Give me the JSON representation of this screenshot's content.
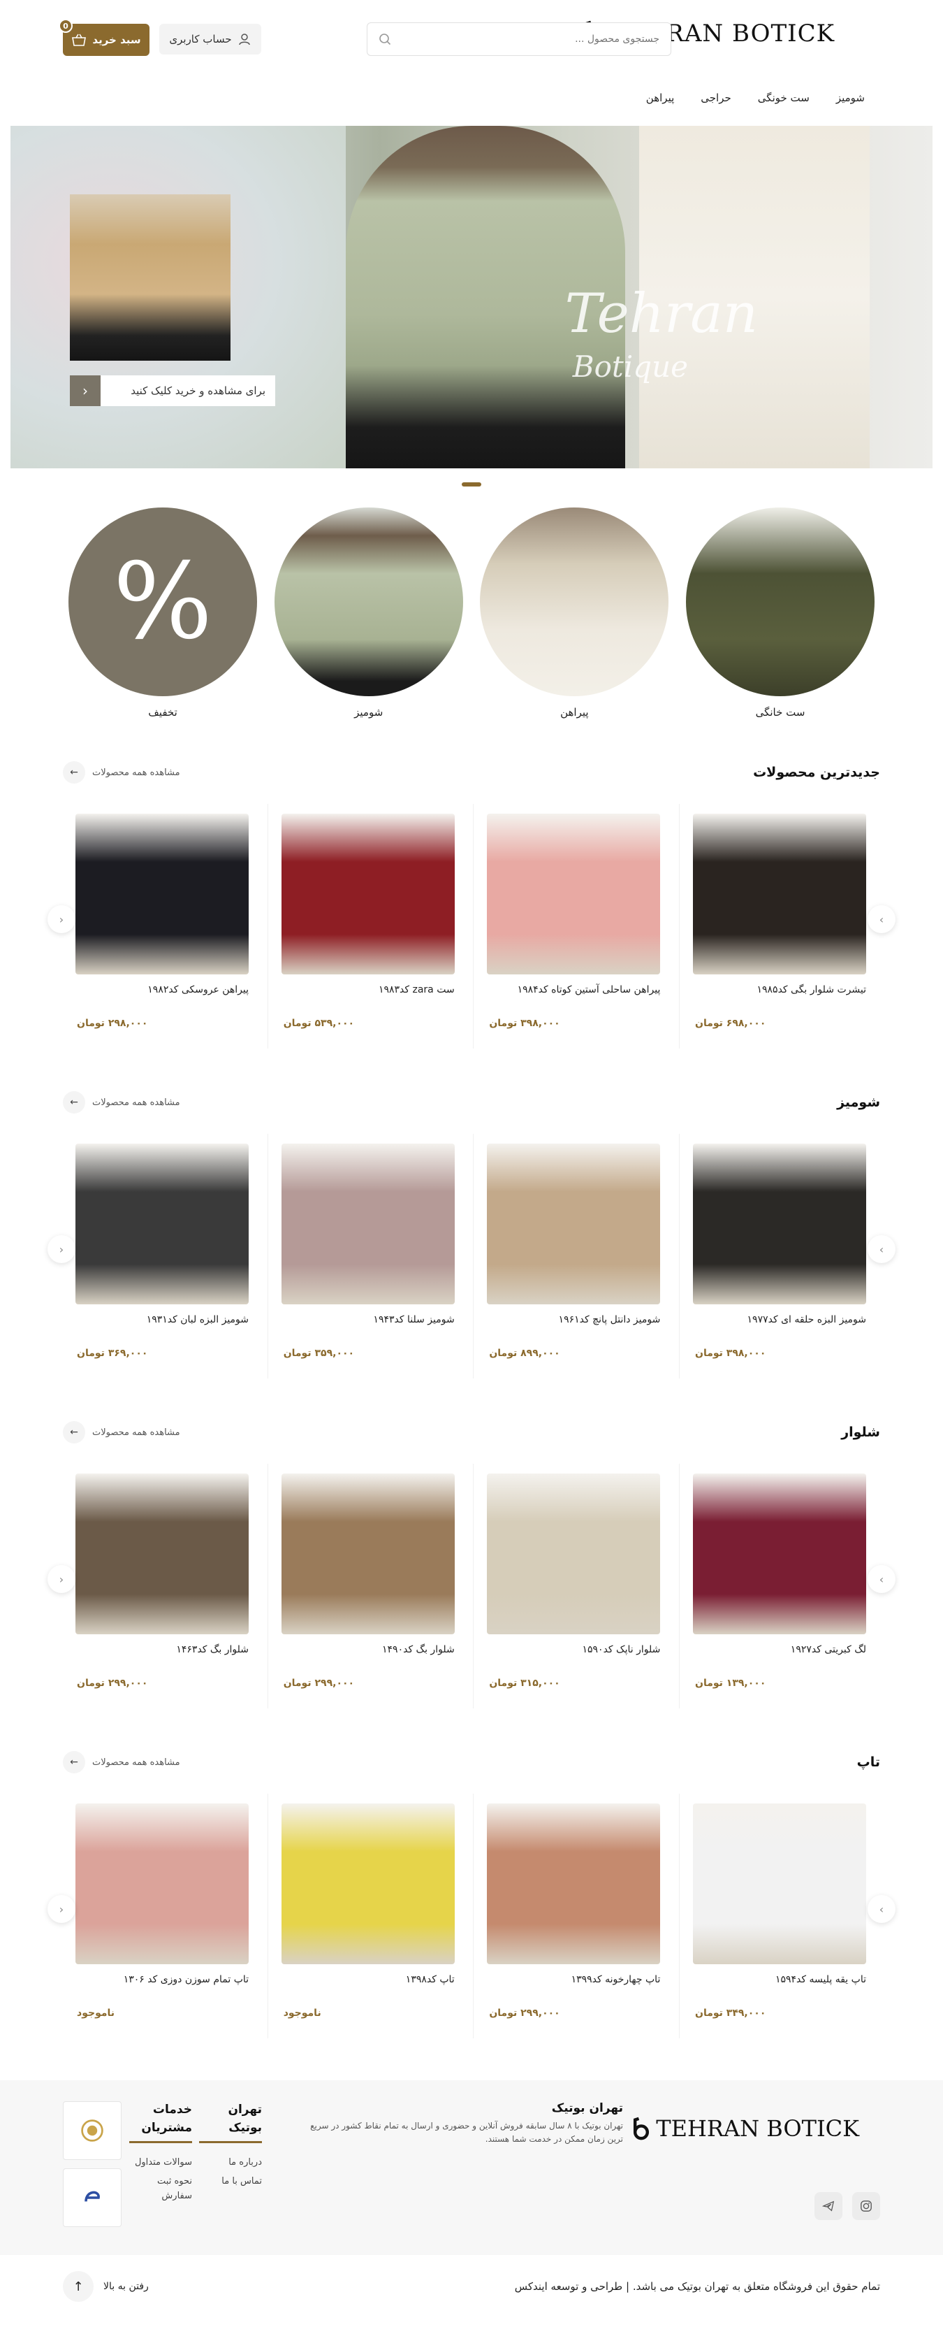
{
  "brand": {
    "logo_text": "TEHRAN BOTICK",
    "accent": "#8b6a2e"
  },
  "header": {
    "search_placeholder": "جستجوی محصول ...",
    "account_label": "حساب کاربری",
    "cart_label": "سبد خرید",
    "cart_count": "0"
  },
  "nav": {
    "items": [
      "شومیز",
      "ست خونگی",
      "حراجی",
      "پیراهن"
    ]
  },
  "hero": {
    "cta_label": "برای مشاهده و خرید کلیک کنید",
    "script_title": "Tehran",
    "script_sub": "Botique"
  },
  "categories": [
    {
      "label": "ست خانگی"
    },
    {
      "label": "پیراهن"
    },
    {
      "label": "شومیز"
    },
    {
      "label": "تخفیف",
      "symbol": "%"
    }
  ],
  "view_all_label": "مشاهده همه محصولات",
  "sections": [
    {
      "title": "جدیدترین محصولات",
      "products": [
        {
          "name": "تیشرت شلوار بگی کد۱۹۸۵",
          "price": "۶۹۸,۰۰۰ تومان",
          "color": "#2a2420"
        },
        {
          "name": "پیراهن ساحلی آستین کوتاه کد۱۹۸۴",
          "price": "۳۹۸,۰۰۰ تومان",
          "color": "#e8a9a3"
        },
        {
          "name": "ست zara کد۱۹۸۳",
          "price": "۵۳۹,۰۰۰ تومان",
          "color": "#8e1e24"
        },
        {
          "name": "پیراهن عروسکی کد۱۹۸۲",
          "price": "۲۹۸,۰۰۰ تومان",
          "color": "#1c1c22"
        }
      ]
    },
    {
      "title": "شومیز",
      "products": [
        {
          "name": "شومیز البزه حلقه ای کد۱۹۷۷",
          "price": "۳۹۸,۰۰۰ تومان",
          "color": "#2b2926"
        },
        {
          "name": "شومیز دانتل پانچ کد۱۹۶۱",
          "price": "۸۹۹,۰۰۰ تومان",
          "color": "#c3a98a"
        },
        {
          "name": "شومیز سلنا کد۱۹۴۳",
          "price": "۳۵۹,۰۰۰ تومان",
          "color": "#b59a97"
        },
        {
          "name": "شومیز البزه لبان کد۱۹۳۱",
          "price": "۳۶۹,۰۰۰ تومان",
          "color": "#3a3a3a"
        }
      ]
    },
    {
      "title": "شلوار",
      "products": [
        {
          "name": "لگ کبریتی کد۱۹۲۷",
          "price": "۱۳۹,۰۰۰ تومان",
          "color": "#7a1e33"
        },
        {
          "name": "شلوار ناپک کد۱۵۹۰",
          "price": "۳۱۵,۰۰۰ تومان",
          "color": "#d6cdb9"
        },
        {
          "name": "شلوار بگ کد۱۴۹۰",
          "price": "۲۹۹,۰۰۰ تومان",
          "color": "#9a7b5a"
        },
        {
          "name": "شلوار بگ کد۱۴۶۳",
          "price": "۲۹۹,۰۰۰ تومان",
          "color": "#6b5a48"
        }
      ]
    },
    {
      "title": "تاپ",
      "products": [
        {
          "name": "تاپ یقه پلیسه کد۱۵۹۴",
          "price": "۳۴۹,۰۰۰ تومان",
          "color": "#f2f2f2"
        },
        {
          "name": "تاپ چهارخونه کد۱۳۹۹",
          "price": "۲۹۹,۰۰۰ تومان",
          "color": "#c58a6e"
        },
        {
          "name": "تاپ کد۱۳۹۸",
          "price": "ناموجود",
          "color": "#e6d44a"
        },
        {
          "name": "تاپ تمام سوزن دوزی کد ۱۳۰۶",
          "price": "ناموجود",
          "color": "#dba39a"
        }
      ]
    }
  ],
  "footer": {
    "about_title": "تهران بوتیک",
    "about_text": "تهران بوتیک با ۸ سال سابقه فروش آنلاین و حضوری و ارسال به تمام نقاط کشور در سریع ترین زمان ممکن در خدمت شما هستند.",
    "col1_title": "تهران بوتیک",
    "col1_links": [
      "درباره ما",
      "تماس با ما"
    ],
    "col2_title": "خدمات مشتریان",
    "col2_links": [
      "سوالات متداول",
      "نحوه ثبت سفارش"
    ],
    "copyright": "تمام حقوق این فروشگاه متعلق به تهران بوتیک می باشد. | طراحی و توسعه ایندکس",
    "back_to_top": "رفتن به بالا"
  }
}
